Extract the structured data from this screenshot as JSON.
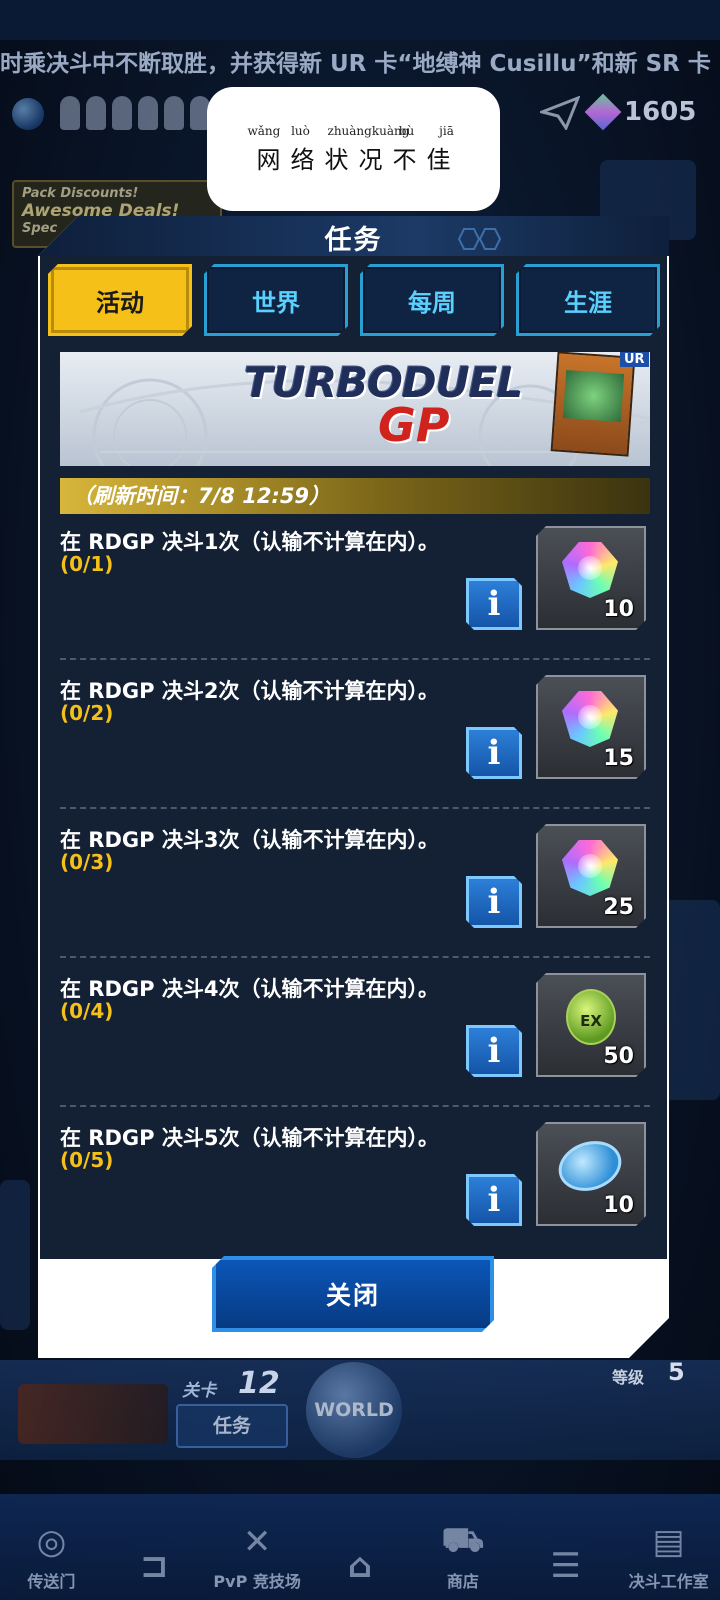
{
  "background": {
    "ticker": "时乘决斗中不断取胜，并获得新 UR 卡“地缚神 Cusillu”和新 SR 卡",
    "gem_count": "1605",
    "pack_discount": {
      "line1": "Pack Discounts!",
      "line2": "Awesome Deals!",
      "line3": "Spec"
    },
    "stage_label": "关卡",
    "stage_number": "12",
    "mission_button": "任务",
    "world_label": "WORLD",
    "level_label": "等级",
    "level_number": "5"
  },
  "nav": {
    "items": [
      {
        "label": "传送门",
        "icon": "portal-icon"
      },
      {
        "label": "",
        "icon": "back-icon"
      },
      {
        "label": "PvP 竞技场",
        "icon": "swords-icon"
      },
      {
        "label": "",
        "icon": "home-icon"
      },
      {
        "label": "商店",
        "icon": "cart-icon"
      },
      {
        "label": "",
        "icon": "menu-icon"
      },
      {
        "label": "决斗工作室",
        "icon": "cards-icon"
      }
    ]
  },
  "toast": {
    "pinyin": [
      "wǎng",
      "luò",
      "zhuàngkuàng",
      "bù",
      "jiā"
    ],
    "chars": [
      "网",
      "络",
      "状",
      "况",
      "不",
      "佳"
    ]
  },
  "dialog": {
    "title": "任务",
    "tabs": [
      {
        "label": "活动",
        "active": true
      },
      {
        "label": "世界",
        "active": false
      },
      {
        "label": "每周",
        "active": false
      },
      {
        "label": "生涯",
        "active": false
      }
    ],
    "banner": {
      "logo_text": "TURBODUEL",
      "logo_sub": "GP",
      "card_rarity": "UR"
    },
    "refresh_text": "（刷新时间：7/8 12:59）",
    "missions": [
      {
        "title": "在 RDGP 决斗1次（认输不计算在内）。",
        "progress": "(0/1)",
        "reward_icon": "gem-icon",
        "reward_qty": "10"
      },
      {
        "title": "在 RDGP 决斗2次（认输不计算在内）。",
        "progress": "(0/2)",
        "reward_icon": "gem-icon",
        "reward_qty": "15"
      },
      {
        "title": "在 RDGP 决斗3次（认输不计算在内）。",
        "progress": "(0/3)",
        "reward_icon": "gem-icon",
        "reward_qty": "25"
      },
      {
        "title": "在 RDGP 决斗4次（认输不计算在内）。",
        "progress": "(0/4)",
        "reward_icon": "ex-orb-icon",
        "reward_qty": "50"
      },
      {
        "title": "在 RDGP 决斗5次（认输不计算在内）。",
        "progress": "(0/5)",
        "reward_icon": "coin-icon",
        "reward_qty": "10"
      }
    ],
    "info_label": "i",
    "close_label": "关闭"
  }
}
